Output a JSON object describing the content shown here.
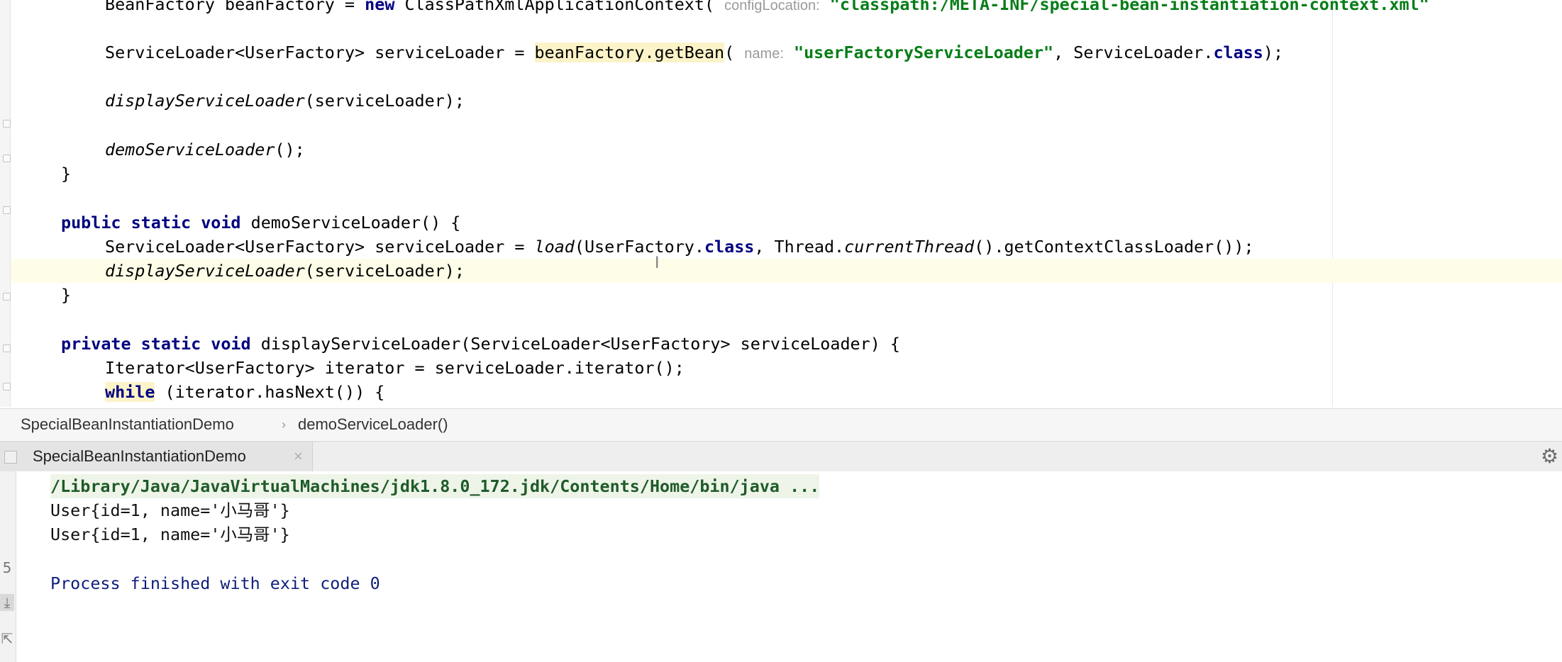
{
  "editor": {
    "lines": [
      {
        "id": "bean-factory-line",
        "segments": [
          {
            "text": "BeanFactory beanFactory = ",
            "style": ""
          },
          {
            "text": "new",
            "style": "kw"
          },
          {
            "text": " ClassPathXmlApplicationContext( ",
            "style": ""
          },
          {
            "text": "configLocation:",
            "style": "hint"
          },
          {
            "text": " ",
            "style": ""
          },
          {
            "text": "\"classpath:/META-INF/special-bean-instantiation-context.xml\"",
            "style": "str"
          }
        ]
      },
      {
        "id": "get-bean-line",
        "segments": [
          {
            "text": "ServiceLoader<UserFactory> serviceLoader = ",
            "style": ""
          },
          {
            "text": "beanFactory.getBean",
            "style": "hl"
          },
          {
            "text": "( ",
            "style": ""
          },
          {
            "text": "name:",
            "style": "hint"
          },
          {
            "text": " ",
            "style": ""
          },
          {
            "text": "\"userFactoryServiceLoader\"",
            "style": "str"
          },
          {
            "text": ", ServiceLoader.",
            "style": ""
          },
          {
            "text": "class",
            "style": "kw"
          },
          {
            "text": ");",
            "style": ""
          }
        ]
      },
      {
        "id": "display-call-line",
        "segments": [
          {
            "text": "displayServiceLoader",
            "style": "it"
          },
          {
            "text": "(serviceLoader);",
            "style": ""
          }
        ]
      },
      {
        "id": "demo-call-line",
        "segments": [
          {
            "text": "demoServiceLoader",
            "style": "it"
          },
          {
            "text": "();",
            "style": ""
          }
        ]
      },
      {
        "id": "close-main-line",
        "segments": [
          {
            "text": "}",
            "style": ""
          }
        ]
      },
      {
        "id": "demo-decl-line",
        "segments": [
          {
            "text": "public",
            "style": "kw"
          },
          {
            "text": " ",
            "style": ""
          },
          {
            "text": "static",
            "style": "kw"
          },
          {
            "text": " ",
            "style": ""
          },
          {
            "text": "void",
            "style": "kw"
          },
          {
            "text": " demoServiceLoader() {",
            "style": ""
          }
        ]
      },
      {
        "id": "load-line",
        "segments": [
          {
            "text": "ServiceLoader<UserFactory> serviceLoader = ",
            "style": ""
          },
          {
            "text": "load",
            "style": "it"
          },
          {
            "text": "(UserFactory.",
            "style": ""
          },
          {
            "text": "class",
            "style": "kw"
          },
          {
            "text": ", Thread.",
            "style": ""
          },
          {
            "text": "currentThread",
            "style": "it"
          },
          {
            "text": "().getContextClassLoader());",
            "style": ""
          }
        ]
      },
      {
        "id": "display-call-line-2",
        "segments": [
          {
            "text": "displayServiceLoader",
            "style": "it"
          },
          {
            "text": "(serviceLoader);",
            "style": ""
          }
        ]
      },
      {
        "id": "close-demo-line",
        "segments": [
          {
            "text": "}",
            "style": ""
          }
        ]
      },
      {
        "id": "display-decl-line",
        "segments": [
          {
            "text": "private",
            "style": "kw"
          },
          {
            "text": " ",
            "style": ""
          },
          {
            "text": "static",
            "style": "kw"
          },
          {
            "text": " ",
            "style": ""
          },
          {
            "text": "void",
            "style": "kw"
          },
          {
            "text": " displayServiceLoader(ServiceLoader<UserFactory> serviceLoader) {",
            "style": ""
          }
        ]
      },
      {
        "id": "iterator-line",
        "segments": [
          {
            "text": "Iterator<UserFactory> iterator = serviceLoader.iterator();",
            "style": ""
          }
        ]
      },
      {
        "id": "while-line",
        "segments": [
          {
            "text": "while",
            "style": "hl-kw"
          },
          {
            "text": " (iterator.hasNext()) {",
            "style": ""
          }
        ]
      }
    ],
    "text_cursor_glyph": "I"
  },
  "breadcrumb": {
    "items": [
      "SpecialBeanInstantiationDemo",
      "demoServiceLoader()"
    ],
    "separator": "›"
  },
  "run_window": {
    "tab_label": "SpecialBeanInstantiationDemo",
    "tab_close": "×",
    "settings_glyph": "⚙",
    "side_buttons": [
      "5",
      "⤓",
      "⇱"
    ],
    "console": {
      "command": "/Library/Java/JavaVirtualMachines/jdk1.8.0_172.jdk/Contents/Home/bin/java ...",
      "output": [
        "User{id=1, name='小马哥'}",
        "User{id=1, name='小马哥'}"
      ],
      "exit_message": "Process finished with exit code 0"
    }
  },
  "colors": {
    "keyword": "#000080",
    "string": "#067d17",
    "parameter_hint": "#9a9a9a",
    "usage_highlight": "#fcf4c8",
    "current_line": "#fefde8"
  }
}
